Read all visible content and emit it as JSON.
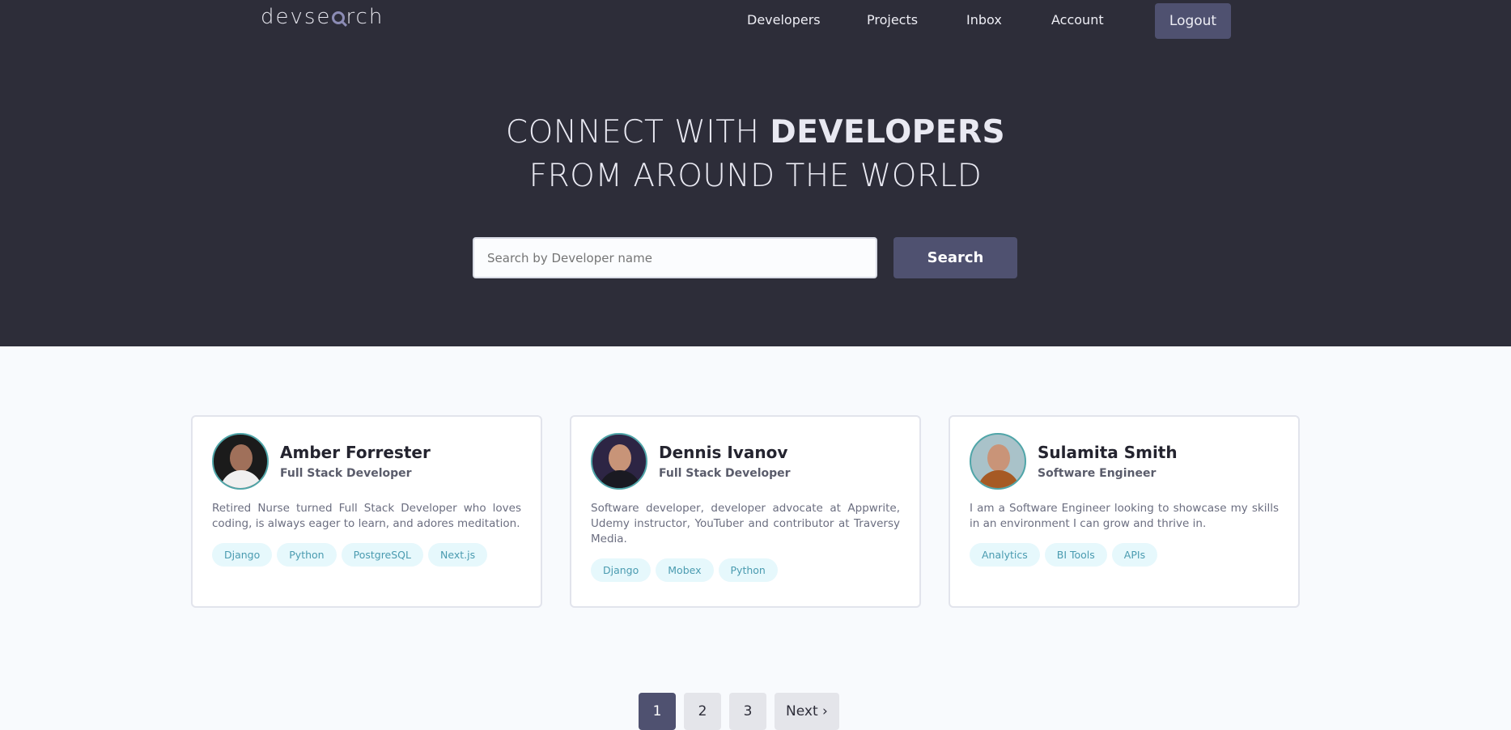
{
  "logo": {
    "text_before": "devse",
    "text_after": "rch"
  },
  "nav": {
    "links": [
      "Developers",
      "Projects",
      "Inbox",
      "Account"
    ],
    "logout_label": "Logout"
  },
  "hero": {
    "line1_light": "CONNECT WITH ",
    "line1_bold": "DEVELOPERS",
    "line2": "FROM AROUND THE WORLD"
  },
  "search": {
    "placeholder": "Search by Developer name",
    "button_label": "Search"
  },
  "developers": [
    {
      "name": "Amber Forrester",
      "role": "Full Stack Developer",
      "bio": "Retired Nurse turned Full Stack Developer who loves coding, is always eager to learn, and adores meditation.",
      "skills": [
        "Django",
        "Python",
        "PostgreSQL",
        "Next.js"
      ],
      "avatar_colors": {
        "bg": "#1b1b1b",
        "face": "#a0705a",
        "body": "#f0f0f0"
      }
    },
    {
      "name": "Dennis Ivanov",
      "role": "Full Stack Developer",
      "bio": "Software developer, developer advocate at Appwrite, Udemy instructor, YouTuber and contributor at Traversy Media.",
      "skills": [
        "Django",
        "Mobex",
        "Python"
      ],
      "avatar_colors": {
        "bg": "#2d2544",
        "face": "#c89478",
        "body": "#1a1a22"
      }
    },
    {
      "name": "Sulamita Smith",
      "role": "Software Engineer",
      "bio": "I am a Software Engineer looking to showcase my skills in an environment I can grow and thrive in.",
      "skills": [
        "Analytics",
        "BI Tools",
        "APIs"
      ],
      "avatar_colors": {
        "bg": "#a9c2c9",
        "face": "#c99478",
        "body": "#a65a24"
      }
    }
  ],
  "pagination": {
    "pages": [
      "1",
      "2",
      "3"
    ],
    "active_page": "1",
    "next_label": "Next ›"
  },
  "colors": {
    "hero_bg": "#2d2d39",
    "accent": "#4f5170",
    "tag_bg": "#e6f8fc",
    "tag_text": "#4a9bb0"
  }
}
